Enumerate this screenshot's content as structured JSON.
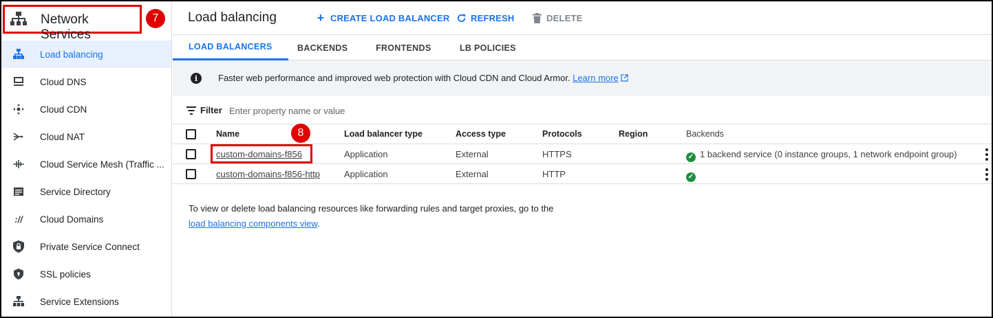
{
  "sidebar": {
    "product_title": "Network Services",
    "product_icon": "network-services-icon",
    "annotation_badge": "7",
    "items": [
      {
        "label": "Load balancing",
        "icon": "load-balancing-icon",
        "active": true
      },
      {
        "label": "Cloud DNS",
        "icon": "dns-icon",
        "active": false
      },
      {
        "label": "Cloud CDN",
        "icon": "cdn-icon",
        "active": false
      },
      {
        "label": "Cloud NAT",
        "icon": "nat-icon",
        "active": false
      },
      {
        "label": "Cloud Service Mesh (Traffic ...",
        "icon": "service-mesh-icon",
        "active": false
      },
      {
        "label": "Service Directory",
        "icon": "service-directory-icon",
        "active": false
      },
      {
        "label": "Cloud Domains",
        "icon": "domains-icon",
        "active": false
      },
      {
        "label": "Private Service Connect",
        "icon": "private-service-connect-icon",
        "active": false
      },
      {
        "label": "SSL policies",
        "icon": "shield-icon",
        "active": false
      },
      {
        "label": "Service Extensions",
        "icon": "service-extensions-icon",
        "active": false
      }
    ]
  },
  "header": {
    "title": "Load balancing",
    "create_label": "CREATE LOAD BALANCER",
    "refresh_label": "REFRESH",
    "delete_label": "DELETE"
  },
  "tabs": [
    {
      "label": "LOAD BALANCERS",
      "active": true
    },
    {
      "label": "BACKENDS",
      "active": false
    },
    {
      "label": "FRONTENDS",
      "active": false
    },
    {
      "label": "LB POLICIES",
      "active": false
    }
  ],
  "banner": {
    "text": "Faster web performance and improved web protection with Cloud CDN and Cloud Armor.",
    "link": "Learn more"
  },
  "filter": {
    "label": "Filter",
    "placeholder": "Enter property name or value"
  },
  "table": {
    "columns": [
      "Name",
      "Load balancer type",
      "Access type",
      "Protocols",
      "Region",
      "Backends"
    ],
    "annotation_badge": "8",
    "rows": [
      {
        "name": "custom-domains-f856",
        "type": "Application",
        "access": "External",
        "protocols": "HTTPS",
        "region": "",
        "backends": "1 backend service (0 instance groups, 1 network endpoint group)"
      },
      {
        "name": "custom-domains-f856-http",
        "type": "Application",
        "access": "External",
        "protocols": "HTTP",
        "region": "",
        "backends": ""
      }
    ]
  },
  "note": {
    "text_before": "To view or delete load balancing resources like forwarding rules and target proxies, go to the",
    "link": "load balancing components view",
    "text_after": "."
  },
  "colors": {
    "accent": "#1a73e8",
    "annotation": "#e00000",
    "success": "#1e8e3e"
  }
}
